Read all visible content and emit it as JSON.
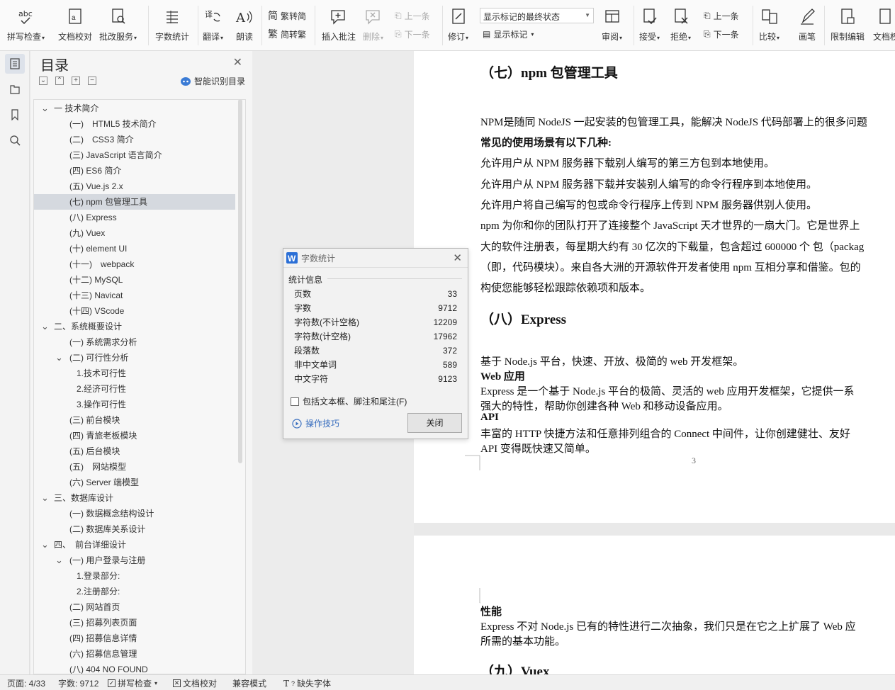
{
  "ribbon": {
    "spell_check": "拼写检查",
    "doc_proof": "文档校对",
    "batch_service": "批改服务",
    "word_count": "字数统计",
    "translate": "翻译",
    "read_aloud": "朗读",
    "trad_to_simp": "繁转简",
    "simp_to_trad": "简转繁",
    "insert_comment": "插入批注",
    "delete": "删除",
    "prev_item": "上一条",
    "next_item": "下一条",
    "revise": "修订",
    "markup_select": "显示标记的最终状态",
    "show_markup": "显示标记",
    "review": "审阅",
    "accept": "接受",
    "reject": "拒绝",
    "prev_item2": "上一条",
    "next_item2": "下一条",
    "compare": "比较",
    "pen": "画笔",
    "restrict_edit": "限制编辑",
    "doc_rights": "文档权"
  },
  "toc": {
    "title": "目录",
    "smart_toc": "智能识别目录",
    "items": [
      {
        "label": "一 技术简介",
        "level": 0,
        "caret": "v"
      },
      {
        "label": "(一)　HTML5 技术简介",
        "level": 1
      },
      {
        "label": "(二)　CSS3 简介",
        "level": 1
      },
      {
        "label": "(三) JavaScript 语言简介",
        "level": 1
      },
      {
        "label": "(四) ES6 简介",
        "level": 1
      },
      {
        "label": "(五) Vue.js 2.x",
        "level": 1
      },
      {
        "label": "(七) npm 包管理工具",
        "level": 1,
        "selected": true
      },
      {
        "label": "(八) Express",
        "level": 1
      },
      {
        "label": "(九) Vuex",
        "level": 1
      },
      {
        "label": "(十) element UI",
        "level": 1
      },
      {
        "label": "(十一)　webpack",
        "level": 1
      },
      {
        "label": "(十二) MySQL",
        "level": 1
      },
      {
        "label": "(十三) Navicat",
        "level": 1
      },
      {
        "label": "(十四) VScode",
        "level": 1
      },
      {
        "label": "二、系统概要设计",
        "level": 0,
        "caret": "v"
      },
      {
        "label": "(一) 系统需求分析",
        "level": 1
      },
      {
        "label": "(二) 可行性分析",
        "level": 1,
        "caret": "v"
      },
      {
        "label": "1.技术可行性",
        "level": 2
      },
      {
        "label": "2.经济可行性",
        "level": 2
      },
      {
        "label": "3.操作可行性",
        "level": 2
      },
      {
        "label": "(三) 前台模块",
        "level": 1
      },
      {
        "label": "(四) 青旅老板模块",
        "level": 1
      },
      {
        "label": "(五) 后台模块",
        "level": 1
      },
      {
        "label": "(五)　网站模型",
        "level": 1
      },
      {
        "label": "(六) Server 端模型",
        "level": 1
      },
      {
        "label": "三、数据库设计",
        "level": 0,
        "caret": "v"
      },
      {
        "label": "(一) 数据概念结构设计",
        "level": 1
      },
      {
        "label": "(二) 数据库关系设计",
        "level": 1
      },
      {
        "label": "四、　前台详细设计",
        "level": 0,
        "caret": "v"
      },
      {
        "label": "(一) 用户登录与注册",
        "level": 1,
        "caret": "v"
      },
      {
        "label": "1.登录部分:",
        "level": 2
      },
      {
        "label": "2.注册部分:",
        "level": 2
      },
      {
        "label": "(二) 网站首页",
        "level": 1
      },
      {
        "label": "(三) 招募列表页面",
        "level": 1
      },
      {
        "label": "(四) 招募信息详情",
        "level": 1
      },
      {
        "label": "(六) 招募信息管理",
        "level": 1
      },
      {
        "label": "(八) 404 NO FOUND",
        "level": 1
      }
    ]
  },
  "dialog": {
    "title": "字数统计",
    "section": "统计信息",
    "rows": [
      {
        "label": "页数",
        "value": "33"
      },
      {
        "label": "字数",
        "value": "9712"
      },
      {
        "label": "字符数(不计空格)",
        "value": "12209"
      },
      {
        "label": "字符数(计空格)",
        "value": "17962"
      },
      {
        "label": "段落数",
        "value": "372"
      },
      {
        "label": "非中文单词",
        "value": "589"
      },
      {
        "label": "中文字符",
        "value": "9123"
      }
    ],
    "checkbox_label": "包括文本框、脚注和尾注(F)",
    "tips": "操作技巧",
    "close": "关闭"
  },
  "document": {
    "h_npm": "（七）npm 包管理工具",
    "p1": "NPM是随同 NodeJS 一起安装的包管理工具，能解决 NodeJS 代码部署上的很多问题",
    "p2": "常见的使用场景有以下几种:",
    "p3": "允许用户从 NPM 服务器下载别人编写的第三方包到本地使用。",
    "p4": "允许用户从 NPM 服务器下载并安装别人编写的命令行程序到本地使用。",
    "p5": "允许用户将自己编写的包或命令行程序上传到 NPM 服务器供别人使用。",
    "p6": "npm 为你和你的团队打开了连接整个 JavaScript 天才世界的一扇大门。它是世界上",
    "p7": "大的软件注册表，每星期大约有 30 亿次的下载量，包含超过 600000 个 包（packag",
    "p8": "（即，代码模块）。来自各大洲的开源软件开发者使用 npm 互相分享和借鉴。包的",
    "p9": "构使您能够轻松跟踪依赖项和版本。",
    "h_express": "（八）Express",
    "e1": "基于 Node.js 平台，快速、开放、极简的 web 开发框架。",
    "e2": "Web 应用",
    "e3": "Express 是一个基于 Node.js 平台的极简、灵活的 web 应用开发框架，它提供一系",
    "e4": "强大的特性，帮助你创建各种 Web 和移动设备应用。",
    "e5": "API",
    "e6": "丰富的 HTTP 快捷方法和任意排列组合的 Connect 中间件，让你创建健壮、友好",
    "e7": "API 变得既快速又简单。",
    "page_num": "3",
    "s1": "性能",
    "s2": "Express 不对 Node.js 已有的特性进行二次抽象，我们只是在它之上扩展了 Web 应",
    "s3": "所需的基本功能。",
    "h_vuex": "（九）Vuex"
  },
  "status": {
    "page": "页面: 4/33",
    "words": "字数: 9712",
    "spell": "拼写检查",
    "proof": "文档校对",
    "compat": "兼容模式",
    "missing_font": "缺失字体"
  }
}
